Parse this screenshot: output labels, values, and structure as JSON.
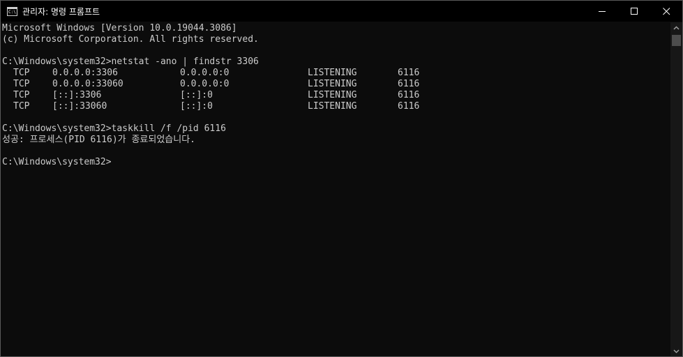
{
  "window": {
    "title": "관리자: 명령 프롬프트",
    "app_icon": "cmd-icon",
    "app_icon_glyph": "C:\\",
    "controls": [
      "minimize-icon",
      "maximize-icon",
      "close-icon"
    ]
  },
  "console": {
    "header": [
      "Microsoft Windows [Version 10.0.19044.3086]",
      "(c) Microsoft Corporation. All rights reserved."
    ],
    "prompt1": "C:\\Windows\\system32>netstat -ano | findstr 3306",
    "netstat_rows": [
      {
        "proto": "TCP",
        "local": "0.0.0.0:3306",
        "foreign": "0.0.0.0:0",
        "state": "LISTENING",
        "pid": "6116"
      },
      {
        "proto": "TCP",
        "local": "0.0.0.0:33060",
        "foreign": "0.0.0.0:0",
        "state": "LISTENING",
        "pid": "6116"
      },
      {
        "proto": "TCP",
        "local": "[::]:3306",
        "foreign": "[::]:0",
        "state": "LISTENING",
        "pid": "6116"
      },
      {
        "proto": "TCP",
        "local": "[::]:33060",
        "foreign": "[::]:0",
        "state": "LISTENING",
        "pid": "6116"
      }
    ],
    "prompt2": "C:\\Windows\\system32>taskkill /f /pid 6116",
    "result": "성공: 프로세스(PID 6116)가 종료되었습니다.",
    "prompt3": "C:\\Windows\\system32>"
  },
  "colors": {
    "background": "#0c0c0c",
    "text": "#cccccc",
    "titlebar": "#000000"
  }
}
